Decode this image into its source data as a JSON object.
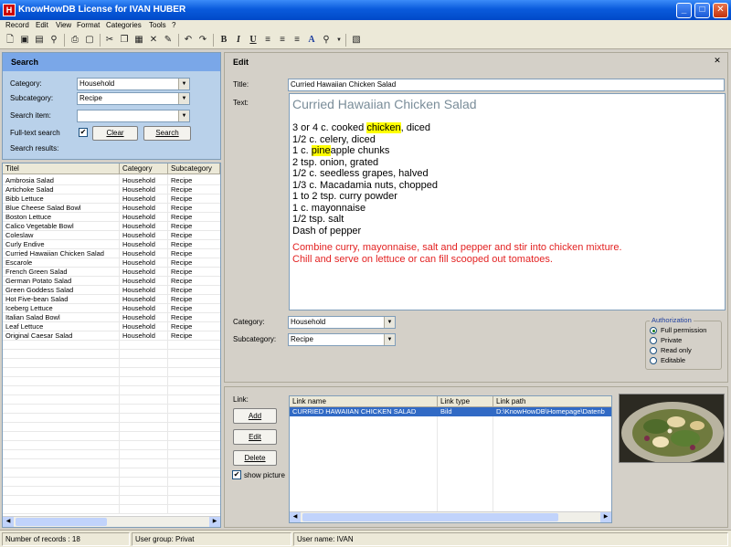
{
  "window": {
    "title": "KnowHowDB License for IVAN HUBER",
    "app_icon": "H",
    "colors": {
      "titlebar": "#0a5bdc",
      "search_header": "#7aa7e8",
      "search_bg": "#b9d1ea",
      "selection": "#316ac5",
      "highlight": "#ffff00",
      "instruction_text": "#e32222"
    }
  },
  "menu": [
    "Record",
    "Edit",
    "View",
    "Format",
    "Categories",
    "Tools",
    "?"
  ],
  "toolbar": {
    "icons": [
      "new-icon",
      "save-icon",
      "delete-icon",
      "find-icon",
      "print-icon",
      "print-preview-icon",
      "cut-icon",
      "copy-icon",
      "paste-icon",
      "clear-icon",
      "brush-icon",
      "undo-icon",
      "redo-icon",
      "bold-icon",
      "italic-icon",
      "underline-icon",
      "align-left-icon",
      "align-center-icon",
      "align-right-icon",
      "font-color-icon",
      "zoom-icon",
      "dropdown-icon",
      "picture-icon"
    ],
    "bold": "B",
    "italic": "I",
    "underline": "U",
    "font_color": "A"
  },
  "search": {
    "header": "Search",
    "category_label": "Category:",
    "category_value": "Household",
    "subcategory_label": "Subcategory:",
    "subcategory_value": "Recipe",
    "search_item_label": "Search item:",
    "search_item_value": "",
    "fulltext_label": "Full-text search",
    "fulltext_checked": "✔",
    "clear_button": "Clear",
    "search_button": "Search",
    "results_label": "Search results:"
  },
  "results": {
    "columns": [
      "Titel",
      "Category",
      "Subcategory"
    ],
    "rows": [
      [
        "Ambrosia Salad",
        "Household",
        "Recipe"
      ],
      [
        "Artichoke Salad",
        "Household",
        "Recipe"
      ],
      [
        "Bibb Lettuce",
        "Household",
        "Recipe"
      ],
      [
        "Blue Cheese Salad Bowl",
        "Household",
        "Recipe"
      ],
      [
        "Boston Lettuce",
        "Household",
        "Recipe"
      ],
      [
        "Calico Vegetable Bowl",
        "Household",
        "Recipe"
      ],
      [
        "Coleslaw",
        "Household",
        "Recipe"
      ],
      [
        "Curly Endive",
        "Household",
        "Recipe"
      ],
      [
        "Curried Hawaiian Chicken Salad",
        "Household",
        "Recipe"
      ],
      [
        "Escarole",
        "Household",
        "Recipe"
      ],
      [
        "French Green Salad",
        "Household",
        "Recipe"
      ],
      [
        "German Potato Salad",
        "Household",
        "Recipe"
      ],
      [
        "Green Goddess Salad",
        "Household",
        "Recipe"
      ],
      [
        "Hot Five-bean Salad",
        "Household",
        "Recipe"
      ],
      [
        "Iceberg Lettuce",
        "Household",
        "Recipe"
      ],
      [
        "Italian Salad Bowl",
        "Household",
        "Recipe"
      ],
      [
        "Leaf Lettuce",
        "Household",
        "Recipe"
      ],
      [
        "Original Caesar Salad",
        "Household",
        "Recipe"
      ]
    ]
  },
  "edit": {
    "header": "Edit",
    "close_glyph": "✕",
    "title_label": "Title:",
    "title_value": "Curried Hawaiian Chicken Salad",
    "text_label": "Text:",
    "text": {
      "heading": "Curried Hawaiian Chicken Salad",
      "l1_pre": "3 or 4 c. cooked ",
      "l1_hl": "chicken",
      "l1_post": ", diced",
      "l2": "1/2 c. celery, diced",
      "l3_pre": "1 c. ",
      "l3_hl": "pine",
      "l3_post": "apple chunks",
      "l4": "2 tsp. onion, grated",
      "l5": "1/2 c. seedless grapes, halved",
      "l6": "1/3 c. Macadamia nuts, chopped",
      "l7": "1 to 2 tsp. curry powder",
      "l8": "1 c. mayonnaise",
      "l9": "1/2 tsp. salt",
      "l10": "Dash of pepper",
      "instructions_1": "Combine curry, mayonnaise, salt and pepper and stir into chicken mixture.",
      "instructions_2": "Chill and serve on lettuce or can fill scooped out tomatoes."
    },
    "category_label": "Category:",
    "category_value": "Household",
    "subcategory_label": "Subcategory:",
    "subcategory_value": "Recipe",
    "authorization": {
      "legend": "Authorization",
      "options": [
        "Full permission",
        "Private",
        "Read only",
        "Editable"
      ],
      "selected": "Full permission"
    }
  },
  "links": {
    "label": "Link:",
    "add_button": "Add",
    "edit_button": "Edit",
    "delete_button": "Delete",
    "show_picture_label": "show picture",
    "show_picture_checked": "✔",
    "columns": [
      "Link name",
      "Link type",
      "Link path"
    ],
    "rows": [
      [
        "CURRIED HAWAIIAN CHICKEN SALAD",
        "Bild",
        "D:\\KnowHowDB\\Homepage\\Datenb"
      ]
    ]
  },
  "status": {
    "records": "Number of records : 18",
    "user_group": "User group: Privat",
    "user_name": "User name: IVAN"
  }
}
